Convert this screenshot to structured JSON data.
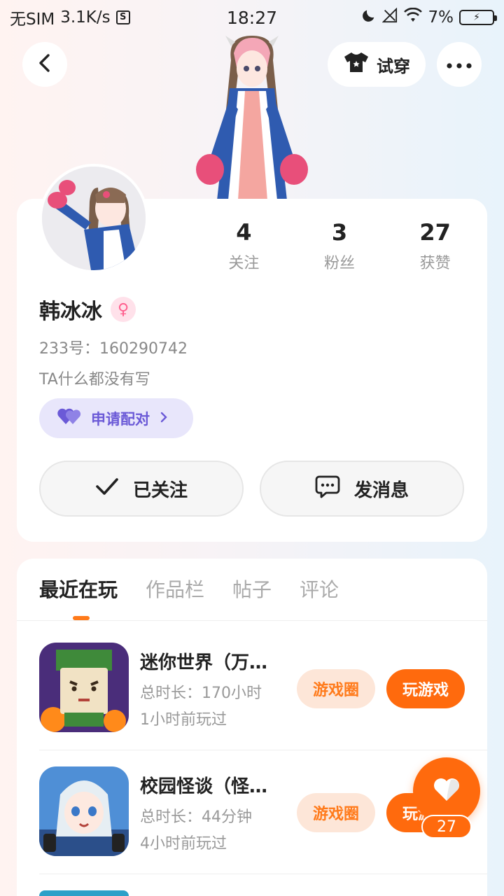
{
  "status_bar": {
    "carrier": "无SIM",
    "speed": "3.1K/s",
    "time": "18:27",
    "battery": "7%"
  },
  "header": {
    "tryon_label": "试穿"
  },
  "profile": {
    "username": "韩冰冰",
    "gender_symbol": "♀",
    "uid": "233号：160290742",
    "bio": "TA什么都没有写",
    "pair_label": "申请配对",
    "stats": [
      {
        "value": "4",
        "label": "关注"
      },
      {
        "value": "3",
        "label": "粉丝"
      },
      {
        "value": "27",
        "label": "获赞"
      }
    ],
    "follow_label": "已关注",
    "message_label": "发消息"
  },
  "tabs": [
    {
      "label": "最近在玩",
      "active": true
    },
    {
      "label": "作品栏",
      "active": false
    },
    {
      "label": "帖子",
      "active": false
    },
    {
      "label": "评论",
      "active": false
    }
  ],
  "games": [
    {
      "title": "迷你世界（万…",
      "duration": "总时长：170小时",
      "last_played": "1小时前玩过",
      "circle_label": "游戏圈",
      "play_label": "玩游戏",
      "icon": "mini-world-icon"
    },
    {
      "title": "校园怪谈（怪…",
      "duration": "总时长：44分钟",
      "last_played": "4小时前玩过",
      "circle_label": "游戏圈",
      "play_label": "玩游戏",
      "icon": "school-ghost-icon"
    }
  ],
  "like_count": "27",
  "colors": {
    "accent": "#ff6a0d",
    "pair_bg": "#e8e6fb",
    "pair_text": "#6b5ad7"
  }
}
